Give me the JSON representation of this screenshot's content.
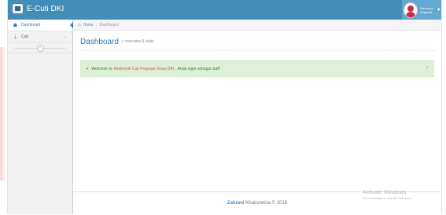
{
  "navbar": {
    "brand": "E-Cuti DKI",
    "user_line1": "Welcome,",
    "user_line2": "Pegawai"
  },
  "sidebar": {
    "items": [
      {
        "label": "Dashboard",
        "icon": "dashboard-icon"
      },
      {
        "label": "Cuti",
        "icon": "pin-icon"
      }
    ],
    "collapse_icon": "double-chevron-left-icon"
  },
  "breadcrumb": {
    "home": "Home",
    "current": "Dashboard"
  },
  "page": {
    "title": "Dashboard",
    "subtitle": "» overview & stats"
  },
  "alert": {
    "prefix": "Welcome to",
    "highlight": "Elektronik Cuti Pegawai Dinas DKI",
    "suffix": ". Anda login sebagai staff",
    "close": "×"
  },
  "footer": {
    "author": "Zahrani",
    "rest": "Khairunnisa © 2018"
  },
  "watermark": {
    "title": "Activate Windows",
    "subtitle": "Go to Settings to activate Windows."
  },
  "colors": {
    "navbar": "#438eb9",
    "accent": "#2679b5",
    "alert_bg": "#dff0d8",
    "alert_text": "#3c763d",
    "highlight": "#d15b47"
  }
}
